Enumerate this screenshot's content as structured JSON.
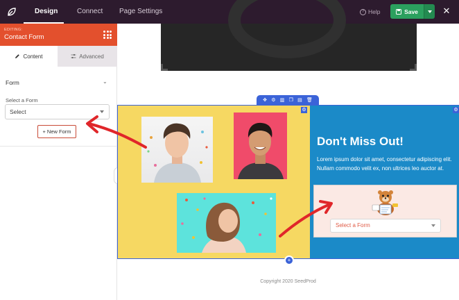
{
  "topbar": {
    "tabs": [
      {
        "label": "Design",
        "active": true
      },
      {
        "label": "Connect",
        "active": false
      },
      {
        "label": "Page Settings",
        "active": false
      }
    ],
    "help_label": "Help",
    "save_label": "Save",
    "colors": {
      "bar": "#2d1b2e",
      "save": "#2ba05e"
    }
  },
  "sidebar": {
    "editing_label": "EDITING:",
    "block_title": "Contact Form",
    "tabs": [
      {
        "label": "Content",
        "icon": "pencil-icon",
        "active": true
      },
      {
        "label": "Advanced",
        "icon": "sliders-icon",
        "active": false
      }
    ],
    "section_title": "Form",
    "select_label": "Select a Form",
    "select_value": "Select",
    "new_form_label": "+ New Form",
    "accent": "#e3502d"
  },
  "canvas": {
    "headline": "Don't Miss Out!",
    "body": "Lorem ipsum dolor sit amet, consectetur adipiscing elit. Nullam commodo velit ex, non ultrices leo auctor at.",
    "form_select_placeholder": "Select a Form",
    "footer": "Copyright 2020 SeedProd",
    "colors": {
      "left_column": "#f6d862",
      "right_column": "#1b8ac8",
      "toolbar": "#3b63d8",
      "arrow": "#e0262a"
    }
  }
}
